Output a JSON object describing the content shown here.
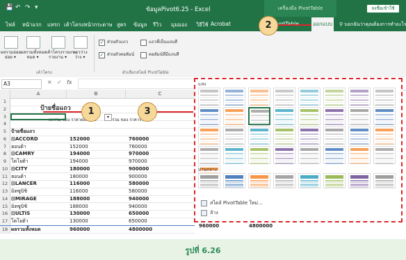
{
  "titlebar": {
    "title": "ข้อมูลPivot6.25 - Excel",
    "context_tab": "เครื่องมือ PivotTable",
    "signin": "ลงชื่อเข้าใช้",
    "quick_access": [
      "💾",
      "↶",
      "↷",
      "▾"
    ]
  },
  "tabs": [
    "ไฟล์",
    "หน้าแรก",
    "แทรก",
    "เค้าโครงหน้ากระดาษ",
    "สูตร",
    "ข้อมูล",
    "รีวิว",
    "มุมมอง",
    "วิธีใช้",
    "Acrobat",
    "PivotTable",
    "ออกแบบ"
  ],
  "tell_me": "บอกฉันว่าคุณต้องการทำอะไร",
  "ribbon": {
    "layout_buttons": [
      "ผลรวมย่อย",
      "ผลรวมทั้งหมด",
      "เค้าโครงรายงาน",
      "แถวว่าง"
    ],
    "layout_sub": [
      "ย่อย ▾",
      "หมด ▾",
      "รายงาน ▾",
      "ว่าง ▾"
    ],
    "layout_group": "เค้าโครง",
    "options": [
      "ส่วนหัวแถว",
      "ส่วนหัวคอลัมน์",
      "แถวที่เป็นแถบสี",
      "คอลัมน์ที่มีแถบสี"
    ],
    "options_group": "ตัวเลือกสไตล์ PivotTable"
  },
  "formula": {
    "cell": "A3",
    "fx": "fx"
  },
  "columns": [
    "A",
    "B",
    "C"
  ],
  "grid": {
    "pivot_title": "ป้ายชื่อแถว",
    "header_b": "ผลรวม ของ ราคาต่อหน่วย",
    "header_c": "ผลรวม ของ ราคารวม",
    "rows": [
      {
        "n": "1",
        "a": "",
        "b": "",
        "c": ""
      },
      {
        "n": "2",
        "a": "",
        "b": "",
        "c": ""
      },
      {
        "n": "3",
        "a": "",
        "b": "",
        "c": ""
      },
      {
        "n": "4",
        "a": "",
        "b": "",
        "c": ""
      },
      {
        "n": "5",
        "a": "ป้ายชื่อแถว",
        "b": "",
        "c": ""
      },
      {
        "n": "6",
        "a": "⊟ACCORD",
        "b": "152000",
        "c": "760000"
      },
      {
        "n": "7",
        "a": "   ฮอนด้า",
        "b": "152000",
        "c": "760000"
      },
      {
        "n": "8",
        "a": "⊟CAMRY",
        "b": "194000",
        "c": "970000"
      },
      {
        "n": "9",
        "a": "   โตโยต้า",
        "b": "194000",
        "c": "970000"
      },
      {
        "n": "10",
        "a": "⊟CITY",
        "b": "180000",
        "c": "900000"
      },
      {
        "n": "11",
        "a": "   ฮอนด้า",
        "b": "180000",
        "c": "900000"
      },
      {
        "n": "12",
        "a": "⊟LANCER",
        "b": "116000",
        "c": "580000"
      },
      {
        "n": "13",
        "a": "   มิตซูบิชิ",
        "b": "116000",
        "c": "580000"
      },
      {
        "n": "14",
        "a": "⊟MIRAGE",
        "b": "188000",
        "c": "940000"
      },
      {
        "n": "15",
        "a": "   มิตซูบิชิ",
        "b": "188000",
        "c": "940000"
      },
      {
        "n": "16",
        "a": "⊟ULTIS",
        "b": "130000",
        "c": "650000"
      },
      {
        "n": "17",
        "a": "   โตโยต้า",
        "b": "130000",
        "c": "650000"
      },
      {
        "n": "18",
        "a": "ผลรวมทั้งหมด",
        "b": "960000",
        "c": "4800000"
      }
    ],
    "right_totals": [
      "960000",
      "4800000"
    ]
  },
  "gallery": {
    "section_light": "แสง",
    "section_medium": "ปานกลาง",
    "new_style": "สไตล์ PivotTable ใหม่...",
    "clear": "ล้าง"
  },
  "palette": {
    "light": [
      "#9e9e9e",
      "#4f81bd",
      "#f79646",
      "#a5a5a5",
      "#4bacc6",
      "#9bbb59",
      "#8064a2"
    ],
    "accent": "#217346",
    "highlight": "#d9262b"
  },
  "callouts": [
    "1",
    "2",
    "3"
  ],
  "caption": "รูปที่ 6.26"
}
